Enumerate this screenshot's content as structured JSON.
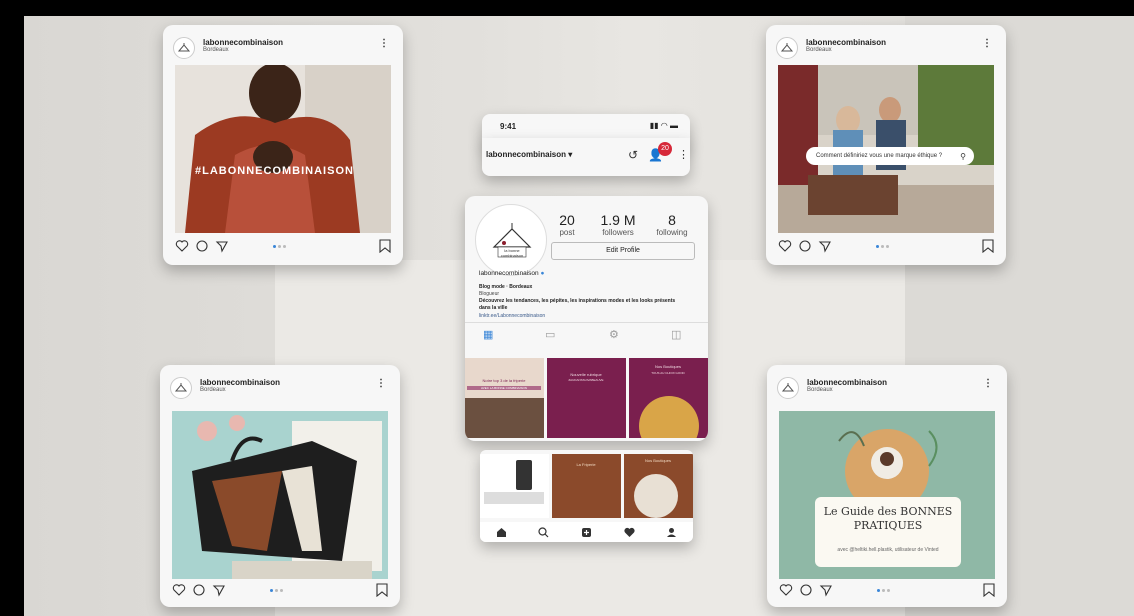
{
  "posts": [
    {
      "username": "labonnecombinaison",
      "location": "Bordeaux",
      "overlay_text": "#LABONNECOMBINAISON"
    },
    {
      "username": "labonnecombinaison",
      "location": "Bordeaux",
      "overlay_text": "Comment définiriez vous une marque éthique ?"
    },
    {
      "username": "labonnecombinaison",
      "location": "Bordeaux",
      "overlay_text": ""
    },
    {
      "username": "labonnecombinaison",
      "location": "Bordeaux",
      "overlay_text": "Le Guide des BONNES PRATIQUES",
      "overlay_sub": "avec @heltiki.hell.plastik, utilisateur de Vinted"
    }
  ],
  "phone": {
    "time": "9:41",
    "account": "labonnecombinaison",
    "notifications": "20",
    "stats": [
      {
        "value": "20",
        "label": "post"
      },
      {
        "value": "1.9 M",
        "label": "followers"
      },
      {
        "value": "8",
        "label": "following"
      }
    ],
    "edit_profile": "Edit Profile",
    "name": "labonnecombinaison",
    "bio_title": "Blog mode · Bordeaux",
    "category": "Blogueur",
    "bio": "Découvrez les tendances, les pépites, les inspirations modes et les looks présents dans la ville",
    "link": "linktr.ee/Labonnecombinaison",
    "logo_text": "la bonne combinaison",
    "tiles": [
      {
        "text": "Notre top 3 de la friperie",
        "sub": "AVEC LA BONNE COMBINAISON"
      },
      {
        "text": "Nouvelle rubrique",
        "sub": "#AUDANSSUIVABEAUVE"
      },
      {
        "text": "Nos Boutiques",
        "sub": "TOUS AU CHOIX GOOD"
      },
      {
        "text": "",
        "sub": ""
      },
      {
        "text": "La Friperie",
        "sub": ""
      },
      {
        "text": "Nos Boutiques",
        "sub": ""
      }
    ]
  },
  "colors": {
    "accent": "#3a86d8",
    "badge": "#d62839",
    "plum": "#7a1f4e",
    "rust": "#8b4a2b",
    "sage": "#8fb8a6",
    "teal": "#a9d3cf"
  }
}
